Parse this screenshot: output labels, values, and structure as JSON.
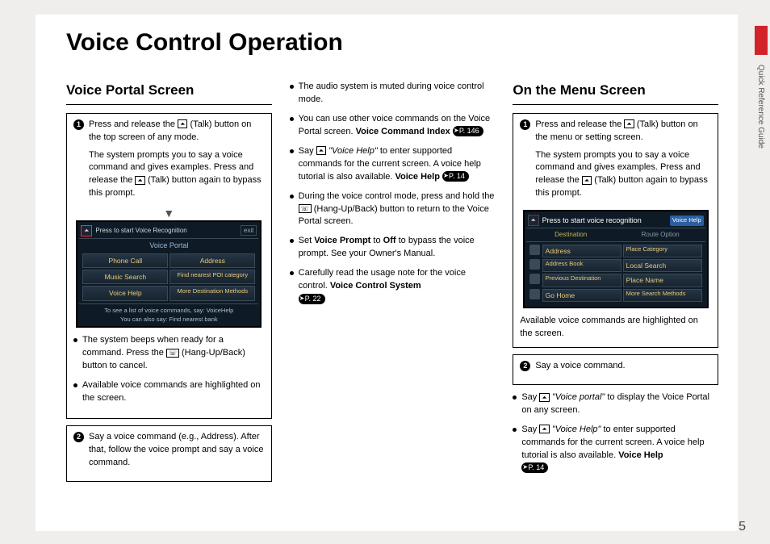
{
  "page_number": "5",
  "side_label": "Quick Reference Guide",
  "title": "Voice Control Operation",
  "talk_label": "(Talk)",
  "hangup_label": "(Hang-Up/Back)",
  "col1": {
    "heading": "Voice Portal Screen",
    "step1": {
      "n": "1",
      "p1a": "Press and release the ",
      "p1b": " (Talk) button on the top screen of any mode.",
      "p2a": "The system prompts you to say a voice command and gives examples. Press and release the ",
      "p2b": " (Talk) button again to bypass this prompt."
    },
    "screen": {
      "head": "Press      to start Voice Recognition",
      "exit": "exit",
      "title": "Voice Portal",
      "b1": "Phone Call",
      "b2": "Address",
      "b3": "Music Search",
      "b4": "Find nearest POI category",
      "b5": "Voice Help",
      "b6": "More Destination Methods",
      "foot1": "To see a list of voice commands, say: VoiceHelp",
      "foot2": "You can also say: Find nearest bank"
    },
    "bul1a": "The system beeps when ready for a command. Press the ",
    "bul1b": " (Hang-Up/Back) button to cancel.",
    "bul2": "Available voice commands are highlighted on the screen.",
    "step2": {
      "n": "2",
      "t": "Say a voice command (e.g., Address). After that, follow the voice prompt and say a voice command."
    }
  },
  "col2": {
    "bul1": "The audio system is muted during voice control mode.",
    "bul2a": "You can use other voice commands on the Voice Portal screen. ",
    "bul2b": "Voice Command Index",
    "p2": "P. 146",
    "bul3a": "Say ",
    "bul3b": " \"Voice Help\"",
    "bul3c": " to enter supported commands for the current screen. A voice help tutorial is also available. ",
    "bul3d": "Voice Help",
    "p3": "P. 14",
    "bul4a": "During the voice control mode, press and hold the ",
    "bul4b": " (Hang-Up/Back) button to return to the Voice Portal screen.",
    "bul5a": "Set ",
    "bul5b": "Voice Prompt",
    "bul5c": " to ",
    "bul5d": "Off",
    "bul5e": " to bypass the voice prompt. See your Owner's Manual.",
    "bul6a": "Carefully read the usage note for the voice control. ",
    "bul6b": "Voice Control System",
    "p6": "P. 22"
  },
  "col3": {
    "heading": "On the Menu Screen",
    "step1": {
      "n": "1",
      "p1a": "Press and release the ",
      "p1b": " (Talk) button on the menu or setting screen.",
      "p2a": "The system prompts you to say a voice command and gives examples. Press and release the ",
      "p2b": " (Talk) button again to bypass this prompt."
    },
    "screen": {
      "head": "Press     to start voice recognition",
      "vh": "Voice Help",
      "tab1": "Destination",
      "tab2": "Route Option",
      "r1a": "Address",
      "r1b": "Place Category",
      "r2a": "Address Book",
      "r2b": "Local Search",
      "r3a": "Previous Destination",
      "r3b": "Place Name",
      "r4a": "Go Home",
      "r4b": "More Search Methods"
    },
    "caption": "Available voice commands are highlighted on the screen.",
    "step2": {
      "n": "2",
      "t": "Say a voice command."
    },
    "bul1a": "Say ",
    "bul1b": " \"Voice portal\"",
    "bul1c": " to display the Voice Portal on any screen.",
    "bul2a": "Say ",
    "bul2b": " \"Voice Help\"",
    "bul2c": " to enter supported commands for the current screen. A voice help tutorial is also available. ",
    "bul2d": "Voice Help",
    "p2": "P. 14"
  }
}
